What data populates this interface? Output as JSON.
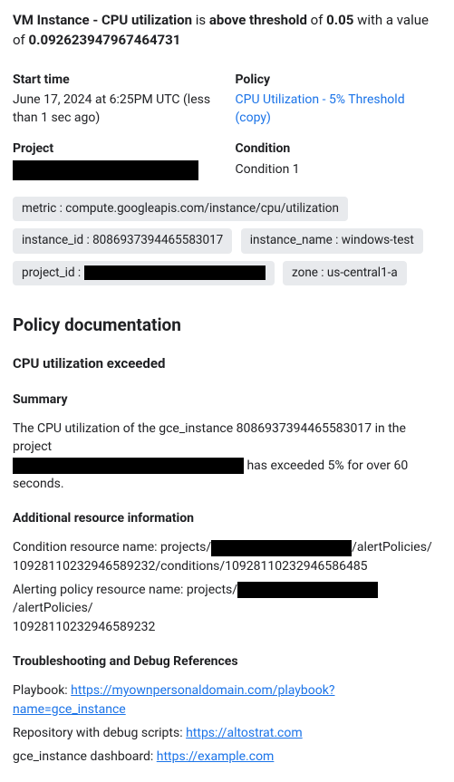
{
  "headline": {
    "p1": "VM Instance - CPU utilization",
    "p2": " is ",
    "p3": "above threshold",
    "p4": " of ",
    "p5": "0.05",
    "p6": " with a value of ",
    "p7": "0.092623947967464731"
  },
  "start": {
    "label": "Start time",
    "value": "June 17, 2024 at 6:25PM UTC (less than 1 sec ago)"
  },
  "policy": {
    "label": "Policy",
    "link": "CPU Utilization - 5% Threshold (copy)"
  },
  "project": {
    "label": "Project"
  },
  "condition": {
    "label": "Condition",
    "value": "Condition 1"
  },
  "chips": {
    "metric": "metric : compute.googleapis.com/instance/cpu/utilization",
    "instance_id": "instance_id : 8086937394465583017",
    "instance_name": "instance_name : windows-test",
    "project_id_prefix": "project_id : ",
    "zone": "zone : us-central1-a"
  },
  "docs": {
    "heading": "Policy documentation",
    "sub": "CPU utilization exceeded",
    "summary_h": "Summary",
    "summary_pre": "The CPU utilization of the gce_instance 8086937394465583017 in the project ",
    "summary_post": " has exceeded 5% for over 60 seconds.",
    "addl_h": "Additional resource information",
    "cond_pre": "Condition resource name: projects/",
    "cond_post": "/alertPolicies/\n10928110232946589232/conditions/10928110232946586485",
    "alert_pre": "Alerting policy resource name: projects/",
    "alert_post": "/alertPolicies/\n10928110232946589232",
    "trouble_h": "Troubleshooting and Debug References",
    "playbook_label": "Playbook: ",
    "playbook_link": "https://myownpersonaldomain.com/playbook?name=gce_instance",
    "repo_label": "Repository with debug scripts: ",
    "repo_link": "https://altostrat.com",
    "dash_label": "gce_instance dashboard: ",
    "dash_link": "https://example.com"
  }
}
